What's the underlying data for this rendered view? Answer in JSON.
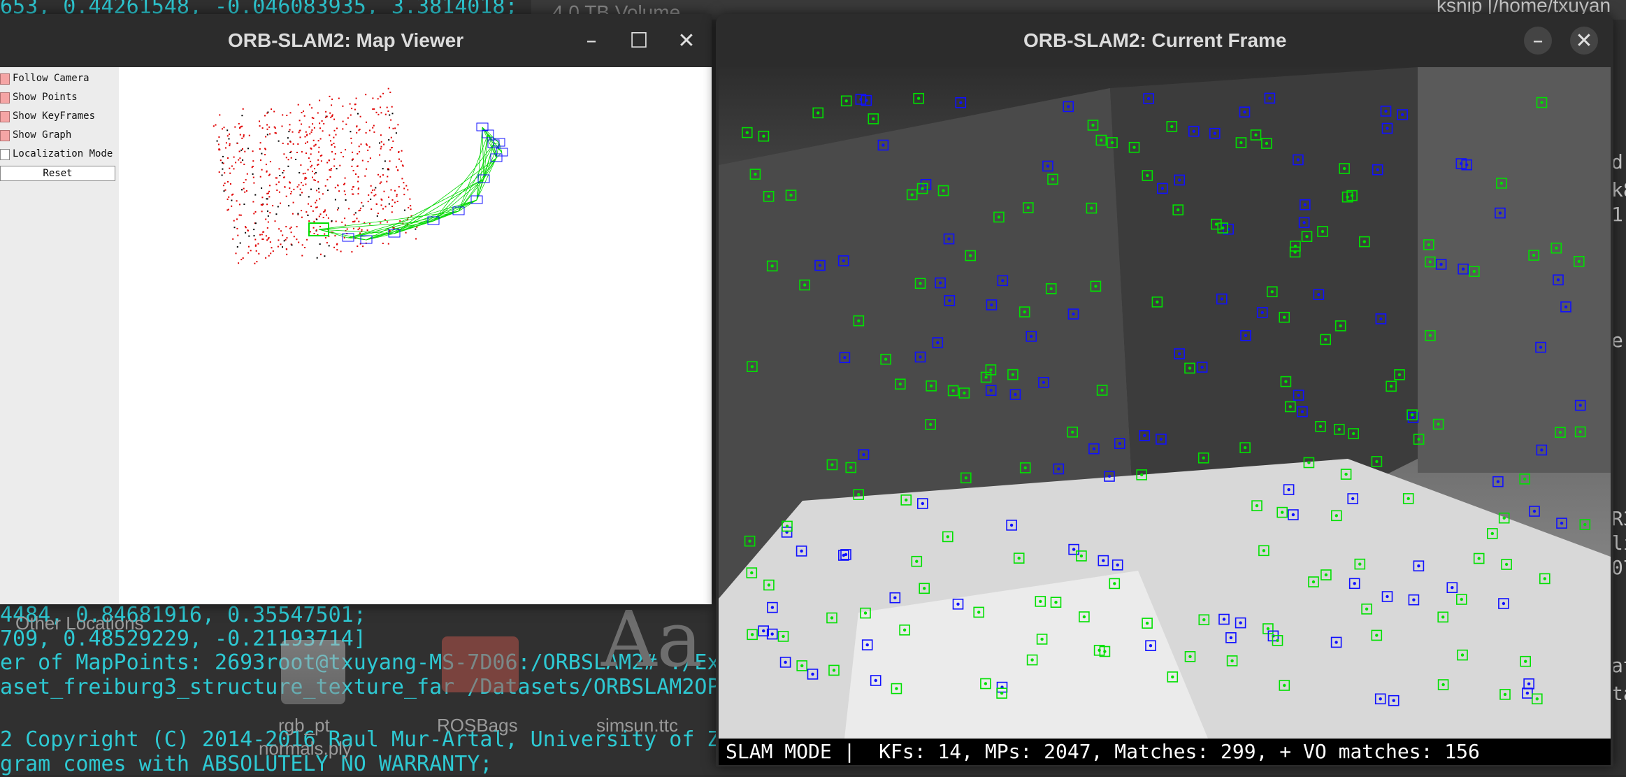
{
  "background": {
    "terminal_lines": [
      "653, 0.44261548, -0.046083935, 3.3814018;",
      "4484, 0.84681916, 0.35547501;",
      "709, 0.48529229, -0.21193714]",
      "er of MapPoints: 2693root@txuyang-MS-7D06:/ORBSLAM2# ./Ex",
      "aset_freiburg3_structure_texture_far /Datasets/ORBSLAM2OP",
      "",
      "2 Copyright (C) 2014-2016 Raul Mur-Artal, University of Z",
      "gram comes with ABSOLUTELY NO WARRANTY;"
    ],
    "desktop_files": [
      "Other Locations",
      "rgb_pt",
      "ROSBags",
      "simsun.ttc",
      "normals.ply"
    ],
    "volume_label": "4.0 TB Volume",
    "other_window_title": "ksnip [/home/txuyan"
  },
  "map_viewer": {
    "title": "ORB-SLAM2: Map Viewer",
    "panel_items": [
      {
        "label": "Follow Camera",
        "checked": true
      },
      {
        "label": "Show Points",
        "checked": true
      },
      {
        "label": "Show KeyFrames",
        "checked": true
      },
      {
        "label": "Show Graph",
        "checked": true
      },
      {
        "label": "Localization Mode",
        "checked": false
      }
    ],
    "reset_label": "Reset",
    "keyframe_count": 14
  },
  "current_frame": {
    "title": "ORB-SLAM2: Current Frame",
    "status_text": "SLAM MODE |  KFs: 14, MPs: 2047, Matches: 299, + VO matches: 156",
    "colors": {
      "tracked": "#00e000",
      "vo": "#1010ff",
      "map_points": "#e00000"
    }
  }
}
